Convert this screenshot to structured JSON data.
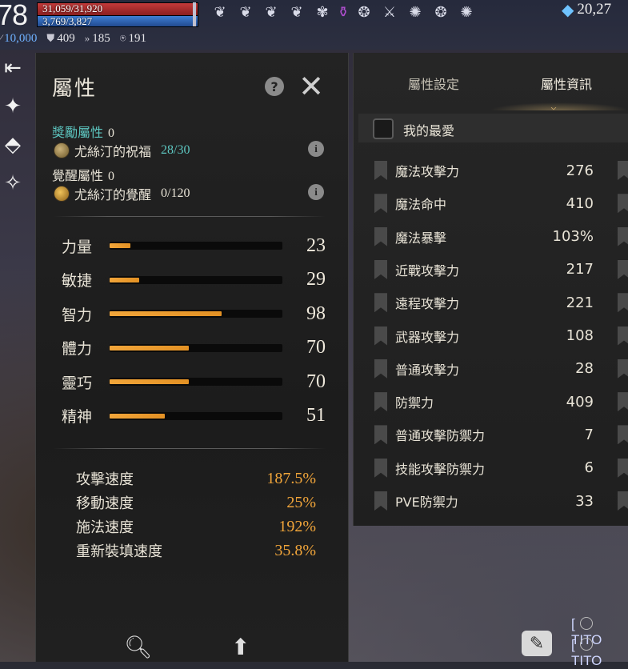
{
  "hud": {
    "level": "78",
    "hp": "31,059/31,920",
    "mp": "3,769/3,827",
    "currency": "20,27",
    "stats": [
      {
        "icon": "mana-icon",
        "value": "10,000"
      },
      {
        "icon": "shield-icon",
        "value": "409"
      },
      {
        "icon": "speed-icon",
        "value": "185"
      },
      {
        "icon": "rank-icon",
        "value": "191"
      }
    ],
    "buffs": [
      "wing-buff-icon",
      "wing-buff-icon",
      "wing-buff-icon",
      "wing-buff-icon",
      "bat-buff-icon",
      "potion-buff-icon",
      "swirl-buff-icon",
      "sword-buff-icon",
      "spiral-buff-icon",
      "swirl-buff-icon",
      "spiral-buff-icon"
    ]
  },
  "attributes_panel": {
    "title": "屬性",
    "bonus": {
      "label": "獎勵屬性",
      "value": "0",
      "item_name": "尤絲汀的祝福",
      "item_count": "28/30"
    },
    "awaken": {
      "label": "覺醒屬性",
      "value": "0",
      "item_name": "尤絲汀的覺醒",
      "item_count": "0/120"
    },
    "stats": [
      {
        "label": "力量",
        "value": "23",
        "fill": 0.12
      },
      {
        "label": "敏捷",
        "value": "29",
        "fill": 0.17
      },
      {
        "label": "智力",
        "value": "98",
        "fill": 0.65
      },
      {
        "label": "體力",
        "value": "70",
        "fill": 0.46
      },
      {
        "label": "靈巧",
        "value": "70",
        "fill": 0.46
      },
      {
        "label": "精神",
        "value": "51",
        "fill": 0.32
      }
    ],
    "speeds": [
      {
        "label": "攻擊速度",
        "value": "187.5%"
      },
      {
        "label": "移動速度",
        "value": "25%"
      },
      {
        "label": "施法速度",
        "value": "192%"
      },
      {
        "label": "重新裝填速度",
        "value": "35.8%"
      }
    ]
  },
  "info_panel": {
    "tabs": [
      "屬性設定",
      "屬性資訊"
    ],
    "active_tab": "屬性資訊",
    "favorites_label": "我的最愛",
    "rows": [
      {
        "name": "魔法攻擊力",
        "value": "276"
      },
      {
        "name": "魔法命中",
        "value": "410"
      },
      {
        "name": "魔法暴擊",
        "value": "103%"
      },
      {
        "name": "近戰攻擊力",
        "value": "217"
      },
      {
        "name": "遠程攻擊力",
        "value": "221"
      },
      {
        "name": "武器攻擊力",
        "value": "108"
      },
      {
        "name": "普通攻擊力",
        "value": "28"
      },
      {
        "name": "防禦力",
        "value": "409"
      },
      {
        "name": "普通攻擊防禦力",
        "value": "7"
      },
      {
        "name": "技能攻擊防禦力",
        "value": "6"
      },
      {
        "name": "PVE防禦力",
        "value": "33"
      }
    ]
  },
  "chat": {
    "lines": [
      "[",
      "["
    ],
    "names": [
      "TITO",
      "TITO"
    ]
  }
}
